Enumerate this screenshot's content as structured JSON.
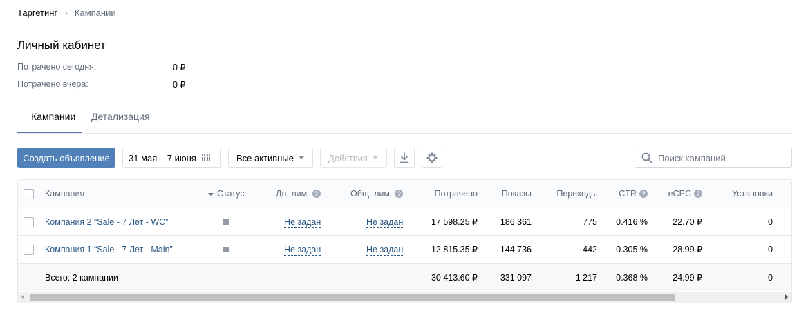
{
  "breadcrumb": {
    "root": "Таргетинг",
    "separator": "›",
    "current": "Кампании"
  },
  "page": {
    "title": "Личный кабинет"
  },
  "spent": {
    "today_label": "Потрачено сегодня:",
    "today_value": "0 ₽",
    "yesterday_label": "Потрачено вчера:",
    "yesterday_value": "0 ₽"
  },
  "tabs": [
    {
      "label": "Кампании",
      "active": true
    },
    {
      "label": "Детализация",
      "active": false
    }
  ],
  "toolbar": {
    "create_label": "Создать объявление",
    "date_range": "31 мая – 7 июня",
    "filter_label": "Все активные",
    "actions_label": "Действия",
    "download_icon": "download-icon",
    "settings_icon": "gear-icon",
    "search_placeholder": "Поиск кампаний"
  },
  "table": {
    "columns": {
      "campaign": "Кампания",
      "status": "Статус",
      "day_limit": "Дн. лим.",
      "total_limit": "Общ. лим.",
      "spent": "Потрачено",
      "shows": "Показы",
      "clicks": "Переходы",
      "ctr": "CTR",
      "ecpc": "eCPC",
      "installs": "Установки"
    },
    "help_glyph": "?",
    "rows": [
      {
        "campaign": "Компания 2 “Sale - 7 Лет - WC”",
        "day_limit": "Не задан",
        "total_limit": "Не задан",
        "spent": "17 598.25 ₽",
        "shows": "186 361",
        "clicks": "775",
        "ctr": "0.416 %",
        "ecpc": "22.70 ₽",
        "installs": "0"
      },
      {
        "campaign": "Компания 1 “Sale - 7 Лет - Main”",
        "day_limit": "Не задан",
        "total_limit": "Не задан",
        "spent": "12 815.35 ₽",
        "shows": "144 736",
        "clicks": "442",
        "ctr": "0.305 %",
        "ecpc": "28.99 ₽",
        "installs": "0"
      }
    ],
    "total": {
      "label": "Всего: 2 кампании",
      "spent": "30 413.60 ₽",
      "shows": "331 097",
      "clicks": "1 217",
      "ctr": "0.368 %",
      "ecpc": "24.99 ₽",
      "installs": "0"
    }
  },
  "colors": {
    "accent": "#5181b8",
    "link": "#2a5885",
    "muted": "#626d7a",
    "border": "#e7e8ec"
  }
}
